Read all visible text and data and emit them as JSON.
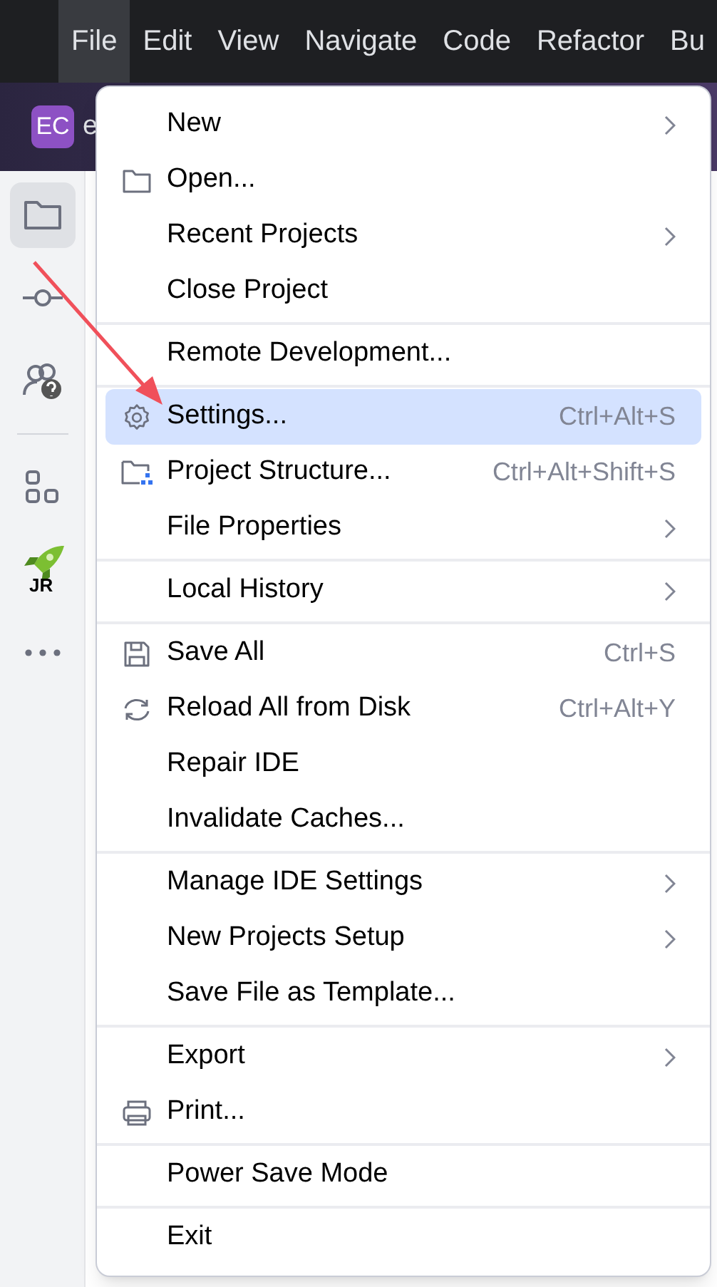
{
  "menu_bar": [
    {
      "label": "File",
      "selected": true
    },
    {
      "label": "Edit",
      "selected": false
    },
    {
      "label": "View",
      "selected": false
    },
    {
      "label": "Navigate",
      "selected": false
    },
    {
      "label": "Code",
      "selected": false
    },
    {
      "label": "Refactor",
      "selected": false
    },
    {
      "label": "Bu",
      "selected": false
    }
  ],
  "project_badge": "EC",
  "project_name": "e",
  "sidebar": [
    [
      {
        "kind": "folder",
        "selected": true
      },
      {
        "kind": "commit",
        "selected": false
      },
      {
        "kind": "help",
        "selected": false
      }
    ],
    [
      {
        "kind": "structure",
        "selected": false
      },
      {
        "kind": "rocket",
        "selected": false,
        "label": "JR"
      },
      {
        "kind": "more",
        "selected": false
      }
    ]
  ],
  "file_menu": [
    [
      {
        "label": "New",
        "submenu": true,
        "selected": false
      },
      {
        "label": "Open...",
        "kind": "folder",
        "selected": false
      },
      {
        "label": "Recent Projects",
        "submenu": true,
        "selected": false
      },
      {
        "label": "Close Project",
        "selected": false
      }
    ],
    [
      {
        "label": "Remote Development...",
        "selected": false
      }
    ],
    [
      {
        "label": "Settings...",
        "kind": "gear",
        "shortcut": "Ctrl+Alt+S",
        "selected": true
      },
      {
        "label": "Project Structure...",
        "kind": "structure",
        "shortcut": "Ctrl+Alt+Shift+S",
        "selected": false
      },
      {
        "label": "File Properties",
        "submenu": true,
        "selected": false
      }
    ],
    [
      {
        "label": "Local History",
        "submenu": true,
        "selected": false
      }
    ],
    [
      {
        "label": "Save All",
        "kind": "save",
        "shortcut": "Ctrl+S",
        "selected": false
      },
      {
        "label": "Reload All from Disk",
        "kind": "reload",
        "shortcut": "Ctrl+Alt+Y",
        "selected": false
      },
      {
        "label": "Repair IDE",
        "selected": false
      },
      {
        "label": "Invalidate Caches...",
        "selected": false
      }
    ],
    [
      {
        "label": "Manage IDE Settings",
        "submenu": true,
        "selected": false
      },
      {
        "label": "New Projects Setup",
        "submenu": true,
        "selected": false
      },
      {
        "label": "Save File as Template...",
        "selected": false
      }
    ],
    [
      {
        "label": "Export",
        "submenu": true,
        "selected": false
      },
      {
        "label": "Print...",
        "kind": "print",
        "selected": false
      }
    ],
    [
      {
        "label": "Power Save Mode",
        "selected": false
      }
    ],
    [
      {
        "label": "Exit",
        "selected": false
      }
    ]
  ]
}
